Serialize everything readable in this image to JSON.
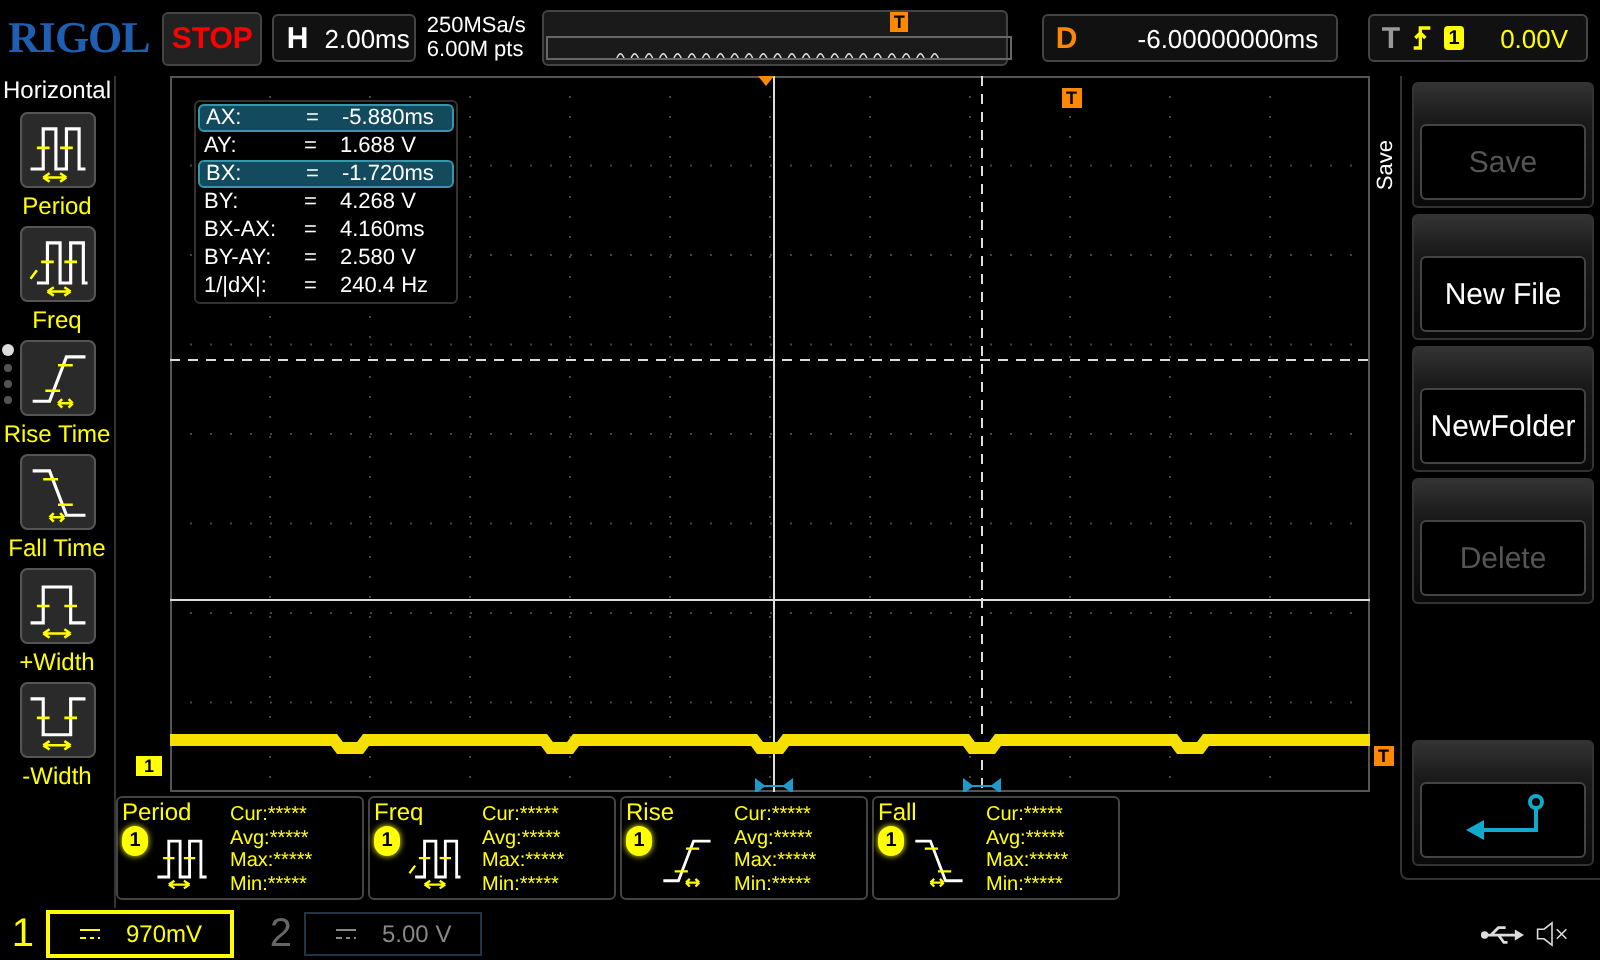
{
  "brand": "RIGOL",
  "run_state": "STOP",
  "timebase": {
    "label": "H",
    "value": "2.00ms"
  },
  "acquisition": {
    "sample_rate": "250MSa/s",
    "memory_depth": "6.00M pts"
  },
  "memory_trigger_marker": "T",
  "delay": {
    "label": "D",
    "value": "-6.00000000ms"
  },
  "trigger": {
    "label": "T",
    "source": "1",
    "level": "0.00V"
  },
  "sidebar": {
    "title": "Horizontal",
    "items": [
      {
        "label": "Period",
        "kind": "period"
      },
      {
        "label": "Freq",
        "kind": "freq"
      },
      {
        "label": "Rise Time",
        "kind": "rise"
      },
      {
        "label": "Fall Time",
        "kind": "fall"
      },
      {
        "label": "+Width",
        "kind": "pwidth"
      },
      {
        "label": "-Width",
        "kind": "nwidth"
      }
    ],
    "pages": [
      {
        "selected": true
      },
      {
        "selected": false
      },
      {
        "selected": false
      },
      {
        "selected": false
      }
    ]
  },
  "cursor_readout": [
    {
      "label": "AX:",
      "equals": "=",
      "value": "-5.880ms",
      "selected": true
    },
    {
      "label": "AY:",
      "equals": "=",
      "value": "1.688 V",
      "selected": false
    },
    {
      "label": "BX:",
      "equals": "=",
      "value": "-1.720ms",
      "selected": true
    },
    {
      "label": "BY:",
      "equals": "=",
      "value": "4.268 V",
      "selected": false
    },
    {
      "label": "BX-AX:",
      "equals": "=",
      "value": "4.160ms",
      "selected": false
    },
    {
      "label": "BY-AY:",
      "equals": "=",
      "value": "2.580 V",
      "selected": false
    },
    {
      "label": "1/|dX|:",
      "equals": "=",
      "value": "240.4 Hz",
      "selected": false
    }
  ],
  "plot_trigger_marker": "T",
  "channel_marker": "1",
  "level_marker": "T",
  "measurements": [
    {
      "name": "Period",
      "channel": "1",
      "kind": "period",
      "stats": [
        "Cur:*****",
        "Avg:*****",
        "Max:*****",
        "Min:*****"
      ]
    },
    {
      "name": "Freq",
      "channel": "1",
      "kind": "freq",
      "stats": [
        "Cur:*****",
        "Avg:*****",
        "Max:*****",
        "Min:*****"
      ]
    },
    {
      "name": "Rise",
      "channel": "1",
      "kind": "rise",
      "stats": [
        "Cur:*****",
        "Avg:*****",
        "Max:*****",
        "Min:*****"
      ]
    },
    {
      "name": "Fall",
      "channel": "1",
      "kind": "fall",
      "stats": [
        "Cur:*****",
        "Avg:*****",
        "Max:*****",
        "Min:*****"
      ]
    }
  ],
  "menu": {
    "title": "Save",
    "buttons": [
      {
        "kind": "text",
        "label": "Save",
        "disabled": true
      },
      {
        "kind": "text",
        "label": "New File",
        "disabled": false
      },
      {
        "kind": "text",
        "label": "NewFolder",
        "disabled": false
      },
      {
        "kind": "text",
        "label": "Delete",
        "disabled": true
      },
      {
        "kind": "back"
      }
    ]
  },
  "channels": [
    {
      "number": "1",
      "scale": "970mV",
      "active": true
    },
    {
      "number": "2",
      "scale": "5.00 V",
      "active": false
    }
  ]
}
